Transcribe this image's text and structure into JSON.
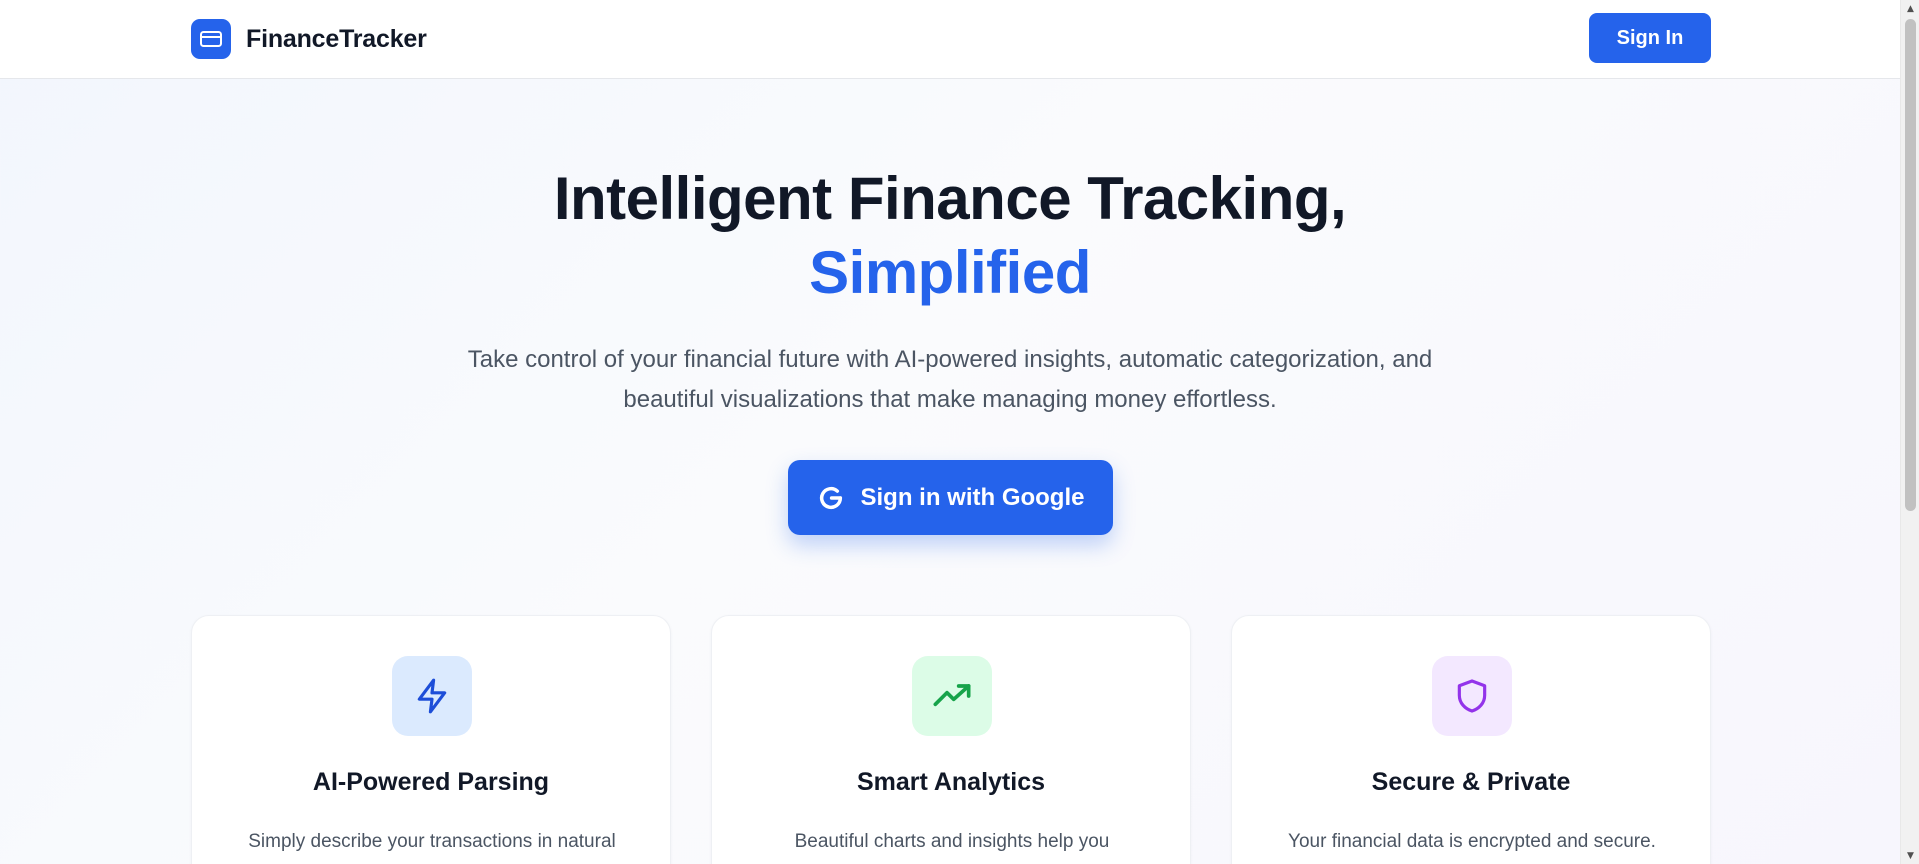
{
  "header": {
    "brand_name": "FinanceTracker",
    "brand_icon": "credit-card-icon",
    "sign_in_label": "Sign In"
  },
  "hero": {
    "title_line1": "Intelligent Finance Tracking,",
    "title_line2": "Simplified",
    "subtitle": "Take control of your financial future with AI-powered insights, automatic categorization, and beautiful visualizations that make managing money effortless.",
    "cta_label": "Sign in with Google",
    "cta_icon": "google-g-icon"
  },
  "features": [
    {
      "title": "AI-Powered Parsing",
      "description": "Simply describe your transactions in natural",
      "icon": "lightning-bolt-icon",
      "icon_color": "#1d4ed8",
      "icon_bg": "#dbeafe"
    },
    {
      "title": "Smart Analytics",
      "description": "Beautiful charts and insights help you",
      "icon": "trending-up-icon",
      "icon_color": "#16a34a",
      "icon_bg": "#dcfce7"
    },
    {
      "title": "Secure & Private",
      "description": "Your financial data is encrypted and secure.",
      "icon": "shield-icon",
      "icon_color": "#9333ea",
      "icon_bg": "#f3e8ff"
    }
  ],
  "colors": {
    "accent": "#2563eb",
    "heading": "#111827",
    "body_text": "#4b5563"
  }
}
